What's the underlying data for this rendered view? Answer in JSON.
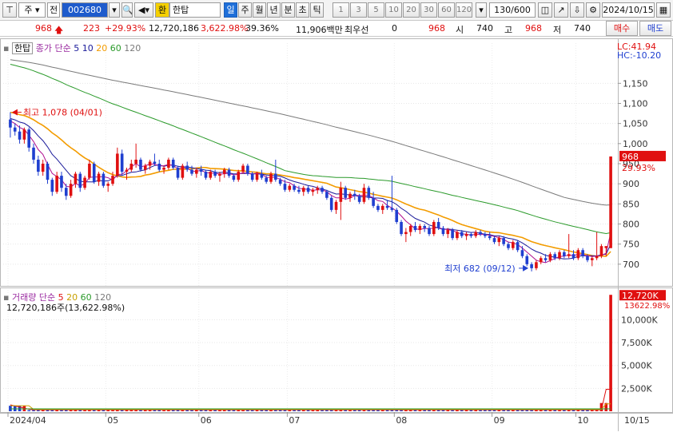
{
  "toolbar": {
    "market_label": "주",
    "prev_label": "전",
    "stock_code": "002680",
    "currency_badge": "환",
    "stock_name": "한탑",
    "periods": [
      "일",
      "주",
      "월",
      "년",
      "분",
      "초",
      "틱"
    ],
    "intervals": [
      "1",
      "3",
      "5",
      "10",
      "20",
      "30",
      "60",
      "120"
    ],
    "count": "130/600",
    "date": "2024/10/15"
  },
  "info": {
    "price": "968",
    "change": "223",
    "change_pct": "+29.93%",
    "volume": "12,720,186",
    "volume_pct": "3,622.98%",
    "turnover": "39.36%",
    "amount": "11,906백만",
    "priority_label": "최우선",
    "priority_value": "0",
    "ask": "968",
    "open_label": "시",
    "open": "740",
    "high_label": "고",
    "high": "968",
    "low_label": "저",
    "low": "740",
    "buy_label": "매수",
    "sell_label": "매도"
  },
  "price_panel": {
    "stock_tag": "한탑",
    "legend_prefix": "종가 단순",
    "ma_periods": [
      "5",
      "10",
      "20",
      "60",
      "120"
    ],
    "ma_colors": [
      "#1a1a9a",
      "#1a1a9a",
      "#f39c00",
      "#2a9a2a",
      "#7a7a7a"
    ],
    "lc": "LC:41.94",
    "hc": "HC:-10.20",
    "current_tag": "968",
    "current_pct": "29.93%",
    "high_annotation": "최고 1,078 (04/01)",
    "low_annotation": "최저 682 (09/12)"
  },
  "volume_panel": {
    "legend_prefix": "거래량 단순",
    "ma_periods": [
      "5",
      "20",
      "60",
      "120"
    ],
    "ma_colors": [
      "#e01010",
      "#c8a000",
      "#2a9a2a",
      "#7a7a7a"
    ],
    "current_line": "12,720,186주(13,622.98%)",
    "current_tag": "12,720K",
    "current_pct": "13622.98%"
  },
  "colors": {
    "up": "#e01010",
    "down": "#1f3fd0",
    "accent": "#1e6fd9"
  },
  "chart_data": [
    {
      "type": "candlestick",
      "title": "한탑 (002680) 일봉",
      "x_labels": [
        "2024/04",
        "05",
        "06",
        "07",
        "08",
        "09",
        "10",
        "10/15"
      ],
      "ylim": [
        650,
        1250
      ],
      "y_ticks": [
        700,
        750,
        800,
        850,
        900,
        950,
        1000,
        1050,
        1100,
        1150
      ],
      "candles": [
        {
          "d": "04/01",
          "o": 1060,
          "h": 1078,
          "l": 1015,
          "c": 1040
        },
        {
          "d": "04/02",
          "o": 1040,
          "h": 1050,
          "l": 1020,
          "c": 1030
        },
        {
          "d": "04/03",
          "o": 1030,
          "h": 1045,
          "l": 1000,
          "c": 1010
        },
        {
          "d": "04/04",
          "o": 1010,
          "h": 1040,
          "l": 1000,
          "c": 1035
        },
        {
          "d": "04/05",
          "o": 1035,
          "h": 1040,
          "l": 980,
          "c": 990
        },
        {
          "d": "04/08",
          "o": 990,
          "h": 1000,
          "l": 950,
          "c": 960
        },
        {
          "d": "04/09",
          "o": 960,
          "h": 970,
          "l": 920,
          "c": 930
        },
        {
          "d": "04/11",
          "o": 930,
          "h": 960,
          "l": 920,
          "c": 950
        },
        {
          "d": "04/12",
          "o": 950,
          "h": 955,
          "l": 900,
          "c": 910
        },
        {
          "d": "04/15",
          "o": 910,
          "h": 915,
          "l": 870,
          "c": 880
        },
        {
          "d": "04/16",
          "o": 880,
          "h": 930,
          "l": 875,
          "c": 920
        },
        {
          "d": "04/17",
          "o": 920,
          "h": 930,
          "l": 880,
          "c": 890
        },
        {
          "d": "04/18",
          "o": 890,
          "h": 900,
          "l": 860,
          "c": 870
        },
        {
          "d": "04/19",
          "o": 870,
          "h": 910,
          "l": 865,
          "c": 900
        },
        {
          "d": "04/22",
          "o": 900,
          "h": 930,
          "l": 890,
          "c": 925
        },
        {
          "d": "04/23",
          "o": 925,
          "h": 930,
          "l": 880,
          "c": 890
        },
        {
          "d": "04/24",
          "o": 890,
          "h": 920,
          "l": 885,
          "c": 915
        },
        {
          "d": "04/25",
          "o": 915,
          "h": 960,
          "l": 910,
          "c": 950
        },
        {
          "d": "04/26",
          "o": 950,
          "h": 955,
          "l": 900,
          "c": 905
        },
        {
          "d": "04/29",
          "o": 905,
          "h": 930,
          "l": 895,
          "c": 925
        },
        {
          "d": "04/30",
          "o": 925,
          "h": 930,
          "l": 890,
          "c": 895
        },
        {
          "d": "05/02",
          "o": 895,
          "h": 905,
          "l": 880,
          "c": 900
        },
        {
          "d": "05/03",
          "o": 900,
          "h": 930,
          "l": 895,
          "c": 920
        },
        {
          "d": "05/07",
          "o": 920,
          "h": 990,
          "l": 915,
          "c": 975
        },
        {
          "d": "05/08",
          "o": 975,
          "h": 985,
          "l": 920,
          "c": 930
        },
        {
          "d": "05/09",
          "o": 930,
          "h": 940,
          "l": 910,
          "c": 935
        },
        {
          "d": "05/10",
          "o": 935,
          "h": 960,
          "l": 930,
          "c": 950
        },
        {
          "d": "05/13",
          "o": 950,
          "h": 1000,
          "l": 940,
          "c": 960
        },
        {
          "d": "05/14",
          "o": 960,
          "h": 965,
          "l": 930,
          "c": 935
        },
        {
          "d": "05/16",
          "o": 935,
          "h": 950,
          "l": 925,
          "c": 945
        },
        {
          "d": "05/17",
          "o": 945,
          "h": 960,
          "l": 935,
          "c": 955
        },
        {
          "d": "05/20",
          "o": 955,
          "h": 975,
          "l": 945,
          "c": 950
        },
        {
          "d": "05/21",
          "o": 950,
          "h": 960,
          "l": 930,
          "c": 935
        },
        {
          "d": "05/22",
          "o": 935,
          "h": 945,
          "l": 925,
          "c": 940
        },
        {
          "d": "05/23",
          "o": 940,
          "h": 965,
          "l": 935,
          "c": 960
        },
        {
          "d": "05/24",
          "o": 960,
          "h": 965,
          "l": 935,
          "c": 940
        },
        {
          "d": "05/27",
          "o": 940,
          "h": 945,
          "l": 910,
          "c": 915
        },
        {
          "d": "05/28",
          "o": 915,
          "h": 950,
          "l": 910,
          "c": 945
        },
        {
          "d": "05/29",
          "o": 945,
          "h": 955,
          "l": 930,
          "c": 935
        },
        {
          "d": "05/30",
          "o": 935,
          "h": 945,
          "l": 920,
          "c": 925
        },
        {
          "d": "05/31",
          "o": 925,
          "h": 940,
          "l": 915,
          "c": 935
        },
        {
          "d": "06/03",
          "o": 935,
          "h": 945,
          "l": 920,
          "c": 930
        },
        {
          "d": "06/04",
          "o": 930,
          "h": 935,
          "l": 910,
          "c": 915
        },
        {
          "d": "06/05",
          "o": 915,
          "h": 935,
          "l": 910,
          "c": 930
        },
        {
          "d": "06/07",
          "o": 930,
          "h": 935,
          "l": 915,
          "c": 920
        },
        {
          "d": "06/10",
          "o": 920,
          "h": 930,
          "l": 905,
          "c": 925
        },
        {
          "d": "06/11",
          "o": 925,
          "h": 940,
          "l": 915,
          "c": 935
        },
        {
          "d": "06/12",
          "o": 935,
          "h": 940,
          "l": 915,
          "c": 920
        },
        {
          "d": "06/13",
          "o": 920,
          "h": 925,
          "l": 905,
          "c": 910
        },
        {
          "d": "06/14",
          "o": 910,
          "h": 935,
          "l": 905,
          "c": 930
        },
        {
          "d": "06/17",
          "o": 930,
          "h": 950,
          "l": 925,
          "c": 945
        },
        {
          "d": "06/18",
          "o": 945,
          "h": 950,
          "l": 920,
          "c": 925
        },
        {
          "d": "06/19",
          "o": 925,
          "h": 930,
          "l": 905,
          "c": 910
        },
        {
          "d": "06/20",
          "o": 910,
          "h": 930,
          "l": 905,
          "c": 925
        },
        {
          "d": "06/21",
          "o": 925,
          "h": 935,
          "l": 910,
          "c": 915
        },
        {
          "d": "06/24",
          "o": 915,
          "h": 920,
          "l": 900,
          "c": 905
        },
        {
          "d": "06/25",
          "o": 905,
          "h": 930,
          "l": 900,
          "c": 925
        },
        {
          "d": "06/26",
          "o": 925,
          "h": 960,
          "l": 905,
          "c": 910
        },
        {
          "d": "06/27",
          "o": 910,
          "h": 915,
          "l": 895,
          "c": 900
        },
        {
          "d": "06/28",
          "o": 900,
          "h": 910,
          "l": 880,
          "c": 885
        },
        {
          "d": "07/01",
          "o": 885,
          "h": 900,
          "l": 880,
          "c": 895
        },
        {
          "d": "07/02",
          "o": 895,
          "h": 900,
          "l": 880,
          "c": 885
        },
        {
          "d": "07/03",
          "o": 885,
          "h": 895,
          "l": 875,
          "c": 880
        },
        {
          "d": "07/04",
          "o": 880,
          "h": 895,
          "l": 870,
          "c": 890
        },
        {
          "d": "07/05",
          "o": 890,
          "h": 895,
          "l": 875,
          "c": 880
        },
        {
          "d": "07/08",
          "o": 880,
          "h": 890,
          "l": 870,
          "c": 885
        },
        {
          "d": "07/09",
          "o": 885,
          "h": 895,
          "l": 875,
          "c": 890
        },
        {
          "d": "07/10",
          "o": 890,
          "h": 895,
          "l": 875,
          "c": 880
        },
        {
          "d": "07/11",
          "o": 880,
          "h": 885,
          "l": 860,
          "c": 865
        },
        {
          "d": "07/12",
          "o": 865,
          "h": 870,
          "l": 830,
          "c": 835
        },
        {
          "d": "07/15",
          "o": 835,
          "h": 860,
          "l": 825,
          "c": 855
        },
        {
          "d": "07/16",
          "o": 855,
          "h": 905,
          "l": 810,
          "c": 890
        },
        {
          "d": "07/17",
          "o": 890,
          "h": 895,
          "l": 860,
          "c": 865
        },
        {
          "d": "07/18",
          "o": 865,
          "h": 880,
          "l": 855,
          "c": 875
        },
        {
          "d": "07/19",
          "o": 875,
          "h": 885,
          "l": 860,
          "c": 870
        },
        {
          "d": "07/22",
          "o": 870,
          "h": 875,
          "l": 850,
          "c": 855
        },
        {
          "d": "07/23",
          "o": 855,
          "h": 900,
          "l": 850,
          "c": 890
        },
        {
          "d": "07/24",
          "o": 890,
          "h": 895,
          "l": 860,
          "c": 865
        },
        {
          "d": "07/25",
          "o": 865,
          "h": 880,
          "l": 840,
          "c": 845
        },
        {
          "d": "07/26",
          "o": 845,
          "h": 850,
          "l": 830,
          "c": 835
        },
        {
          "d": "07/29",
          "o": 835,
          "h": 850,
          "l": 825,
          "c": 845
        },
        {
          "d": "07/30",
          "o": 845,
          "h": 860,
          "l": 835,
          "c": 840
        },
        {
          "d": "07/31",
          "o": 840,
          "h": 920,
          "l": 830,
          "c": 835
        },
        {
          "d": "08/01",
          "o": 835,
          "h": 840,
          "l": 800,
          "c": 805
        },
        {
          "d": "08/02",
          "o": 805,
          "h": 810,
          "l": 770,
          "c": 775
        },
        {
          "d": "08/05",
          "o": 775,
          "h": 790,
          "l": 755,
          "c": 780
        },
        {
          "d": "08/06",
          "o": 780,
          "h": 800,
          "l": 770,
          "c": 795
        },
        {
          "d": "08/07",
          "o": 795,
          "h": 805,
          "l": 780,
          "c": 785
        },
        {
          "d": "08/08",
          "o": 785,
          "h": 800,
          "l": 775,
          "c": 795
        },
        {
          "d": "08/09",
          "o": 795,
          "h": 800,
          "l": 780,
          "c": 790
        },
        {
          "d": "08/12",
          "o": 790,
          "h": 795,
          "l": 770,
          "c": 775
        },
        {
          "d": "08/13",
          "o": 775,
          "h": 810,
          "l": 770,
          "c": 805
        },
        {
          "d": "08/14",
          "o": 805,
          "h": 815,
          "l": 785,
          "c": 790
        },
        {
          "d": "08/16",
          "o": 790,
          "h": 795,
          "l": 770,
          "c": 775
        },
        {
          "d": "08/19",
          "o": 775,
          "h": 790,
          "l": 765,
          "c": 785
        },
        {
          "d": "08/20",
          "o": 785,
          "h": 790,
          "l": 760,
          "c": 765
        },
        {
          "d": "08/21",
          "o": 765,
          "h": 785,
          "l": 760,
          "c": 780
        },
        {
          "d": "08/22",
          "o": 780,
          "h": 785,
          "l": 765,
          "c": 770
        },
        {
          "d": "08/23",
          "o": 770,
          "h": 780,
          "l": 760,
          "c": 775
        },
        {
          "d": "08/26",
          "o": 775,
          "h": 780,
          "l": 765,
          "c": 770
        },
        {
          "d": "08/27",
          "o": 770,
          "h": 785,
          "l": 765,
          "c": 780
        },
        {
          "d": "08/28",
          "o": 780,
          "h": 785,
          "l": 770,
          "c": 775
        },
        {
          "d": "08/29",
          "o": 775,
          "h": 780,
          "l": 765,
          "c": 770
        },
        {
          "d": "08/30",
          "o": 770,
          "h": 780,
          "l": 760,
          "c": 765
        },
        {
          "d": "09/02",
          "o": 765,
          "h": 770,
          "l": 750,
          "c": 755
        },
        {
          "d": "09/03",
          "o": 755,
          "h": 770,
          "l": 745,
          "c": 765
        },
        {
          "d": "09/04",
          "o": 765,
          "h": 770,
          "l": 745,
          "c": 750
        },
        {
          "d": "09/05",
          "o": 750,
          "h": 755,
          "l": 735,
          "c": 740
        },
        {
          "d": "09/06",
          "o": 740,
          "h": 760,
          "l": 735,
          "c": 755
        },
        {
          "d": "09/09",
          "o": 755,
          "h": 760,
          "l": 730,
          "c": 735
        },
        {
          "d": "09/10",
          "o": 735,
          "h": 745,
          "l": 715,
          "c": 720
        },
        {
          "d": "09/11",
          "o": 720,
          "h": 725,
          "l": 695,
          "c": 700
        },
        {
          "d": "09/12",
          "o": 700,
          "h": 705,
          "l": 682,
          "c": 690
        },
        {
          "d": "09/13",
          "o": 690,
          "h": 710,
          "l": 685,
          "c": 705
        },
        {
          "d": "09/19",
          "o": 705,
          "h": 720,
          "l": 700,
          "c": 715
        },
        {
          "d": "09/20",
          "o": 715,
          "h": 725,
          "l": 705,
          "c": 710
        },
        {
          "d": "09/23",
          "o": 710,
          "h": 730,
          "l": 705,
          "c": 725
        },
        {
          "d": "09/24",
          "o": 725,
          "h": 730,
          "l": 710,
          "c": 715
        },
        {
          "d": "09/25",
          "o": 715,
          "h": 735,
          "l": 710,
          "c": 730
        },
        {
          "d": "09/26",
          "o": 730,
          "h": 735,
          "l": 715,
          "c": 720
        },
        {
          "d": "09/27",
          "o": 720,
          "h": 775,
          "l": 715,
          "c": 725
        },
        {
          "d": "09/30",
          "o": 725,
          "h": 735,
          "l": 710,
          "c": 715
        },
        {
          "d": "10/02",
          "o": 715,
          "h": 740,
          "l": 710,
          "c": 735
        },
        {
          "d": "10/04",
          "o": 735,
          "h": 740,
          "l": 715,
          "c": 720
        },
        {
          "d": "10/07",
          "o": 720,
          "h": 725,
          "l": 705,
          "c": 710
        },
        {
          "d": "10/08",
          "o": 710,
          "h": 720,
          "l": 695,
          "c": 715
        },
        {
          "d": "10/10",
          "o": 715,
          "h": 780,
          "l": 710,
          "c": 720
        },
        {
          "d": "10/11",
          "o": 720,
          "h": 750,
          "l": 715,
          "c": 745
        },
        {
          "d": "10/14",
          "o": 740,
          "h": 745,
          "l": 720,
          "c": 745
        },
        {
          "d": "10/15",
          "o": 740,
          "h": 968,
          "l": 740,
          "c": 968
        }
      ]
    },
    {
      "type": "bar",
      "title": "거래량",
      "ylim": [
        0,
        13000
      ],
      "y_ticks": [
        2500,
        5000,
        7500,
        10000
      ],
      "y_tick_labels": [
        "2,500K",
        "5,000K",
        "7,500K",
        "10,000K"
      ],
      "unit": "K",
      "last_value": 12720
    }
  ]
}
